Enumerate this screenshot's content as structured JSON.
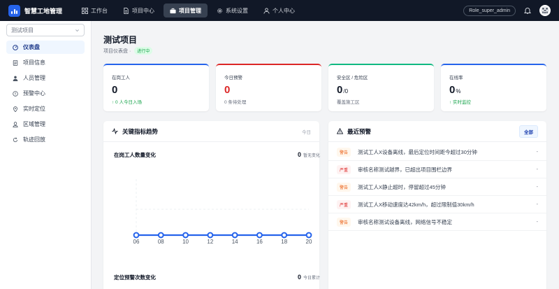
{
  "app": {
    "name": "智慧工地管理"
  },
  "topnav": [
    {
      "label": "工作台",
      "icon": "grid-icon",
      "active": false
    },
    {
      "label": "项目中心",
      "icon": "document-icon",
      "active": false
    },
    {
      "label": "项目管理",
      "icon": "briefcase-icon",
      "active": true
    },
    {
      "label": "系统设置",
      "icon": "gear-icon",
      "active": false
    },
    {
      "label": "个人中心",
      "icon": "user-icon",
      "active": false
    }
  ],
  "user": {
    "role": "Role_super_admin"
  },
  "sidebar": {
    "project_select": "测试项目",
    "items": [
      {
        "label": "仪表盘",
        "icon": "dashboard-icon",
        "active": true
      },
      {
        "label": "项目信息",
        "icon": "info-doc-icon",
        "active": false
      },
      {
        "label": "人员管理",
        "icon": "person-icon",
        "active": false
      },
      {
        "label": "预警中心",
        "icon": "alert-circle-icon",
        "active": false
      },
      {
        "label": "实时定位",
        "icon": "location-pin-icon",
        "active": false
      },
      {
        "label": "区域管理",
        "icon": "map-icon",
        "active": false
      },
      {
        "label": "轨迹回放",
        "icon": "replay-icon",
        "active": false
      }
    ]
  },
  "page": {
    "title": "测试项目",
    "subtitle": "项目仪表盘 ·",
    "status": "进行中"
  },
  "stats": [
    {
      "label": "在岗工人",
      "value": "0",
      "suffix": "",
      "foot": "↑ 0 人今日入场",
      "foot_style": "green",
      "color": "#2563eb"
    },
    {
      "label": "今日预警",
      "value": "0",
      "suffix": "",
      "foot": "0 条待处理",
      "foot_style": "gray",
      "color": "#dc2626"
    },
    {
      "label": "安全区 / 危险区",
      "value": "0",
      "suffix": "/0",
      "foot": "覆盖施工区",
      "foot_style": "gray",
      "color": "#10b981"
    },
    {
      "label": "在线率",
      "value": "0",
      "suffix": "%",
      "foot": "↑ 实时监控",
      "foot_style": "green",
      "color": "#2563eb"
    }
  ],
  "trend_panel": {
    "title": "关键指标趋势",
    "tag": "今日",
    "metric1": {
      "label": "在岗工人数量变化",
      "value": "0",
      "note": "暂无变化"
    },
    "metric2": {
      "label": "定位预警次数变化",
      "value": "0",
      "note": "今日累计"
    }
  },
  "chart_data": {
    "type": "line",
    "x": [
      "06",
      "08",
      "10",
      "12",
      "14",
      "16",
      "18",
      "20"
    ],
    "values": [
      0,
      0,
      0,
      0,
      0,
      0,
      0,
      0
    ],
    "color": "#2563eb"
  },
  "alerts_panel": {
    "title": "最近预警",
    "all_label": "全部",
    "items": [
      {
        "tag": "警告",
        "level": "warn",
        "text": "测试工人X设备离线，最后定位时间距今超过30分钟",
        "time": "-"
      },
      {
        "tag": "严重",
        "level": "severe",
        "text": "审核名称测试越界，已超出项目围栏边界",
        "time": "-"
      },
      {
        "tag": "警告",
        "level": "warn",
        "text": "测试工人X静止超时，停留超过45分钟",
        "time": "-"
      },
      {
        "tag": "严重",
        "level": "severe",
        "text": "测试工人X移动速度达42km/h，超过限制值30km/h",
        "time": "-"
      },
      {
        "tag": "警告",
        "level": "warn",
        "text": "审核名称测试设备离线，网络信号不稳定",
        "time": "-"
      }
    ]
  }
}
